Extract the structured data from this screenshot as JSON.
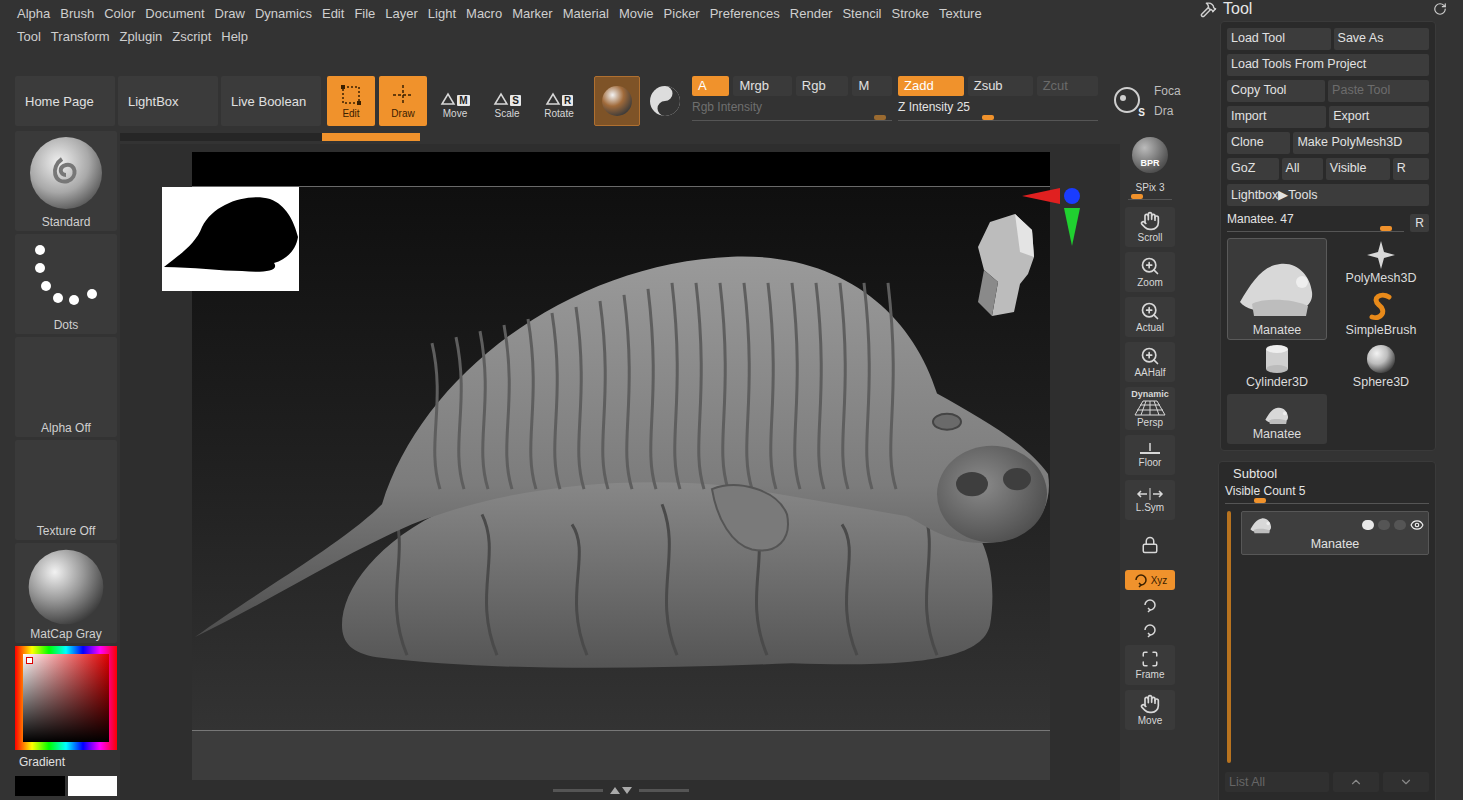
{
  "menu_bar": {
    "rows": [
      [
        "Alpha",
        "Brush",
        "Color",
        "Document",
        "Draw",
        "Dynamics",
        "Edit",
        "File",
        "Layer",
        "Light",
        "Macro",
        "Marker",
        "Material",
        "Movie",
        "Picker",
        "Preferences",
        "Render",
        "Stencil",
        "Stroke",
        "Texture"
      ],
      [
        "Tool",
        "Transform",
        "Zplugin",
        "Zscript",
        "Help"
      ]
    ]
  },
  "top_shelf": {
    "nav_buttons": [
      {
        "label": "Home Page"
      },
      {
        "label": "LightBox"
      },
      {
        "label": "Live Boolean"
      }
    ],
    "modes": [
      {
        "label": "Edit",
        "key": "",
        "kind": "edit",
        "selected": true
      },
      {
        "label": "Draw",
        "key": "",
        "kind": "draw",
        "selected": true
      },
      {
        "label": "Move",
        "key": "M",
        "kind": "key",
        "selected": false
      },
      {
        "label": "Scale",
        "key": "S",
        "kind": "key",
        "selected": false
      },
      {
        "label": "Rotate",
        "key": "R",
        "kind": "key",
        "selected": false
      }
    ],
    "color_modes": [
      {
        "label": "A",
        "selected": true,
        "disabled": false
      },
      {
        "label": "Mrgb",
        "selected": false,
        "disabled": false
      },
      {
        "label": "Rgb",
        "selected": false,
        "disabled": false
      },
      {
        "label": "M",
        "selected": false,
        "disabled": false
      }
    ],
    "z_modes": [
      {
        "label": "Zadd",
        "selected": true,
        "disabled": false
      },
      {
        "label": "Zsub",
        "selected": false,
        "disabled": false
      },
      {
        "label": "Zcut",
        "selected": false,
        "disabled": true
      }
    ],
    "sliders": [
      {
        "label": "Rgb Intensity",
        "level": 0.97,
        "disabled": true
      },
      {
        "label": "Z Intensity 25",
        "level": 0.48,
        "disabled": false
      }
    ],
    "stroke_key": "S",
    "cut_labels": [
      "Foca",
      "Dra"
    ]
  },
  "left_shelf": {
    "tiles": [
      {
        "label": "Standard",
        "kind": "brush"
      },
      {
        "label": "Dots",
        "kind": "stroke"
      },
      {
        "label": "Alpha Off",
        "kind": "empty"
      },
      {
        "label": "Texture Off",
        "kind": "empty"
      },
      {
        "label": "MatCap Gray",
        "kind": "material"
      }
    ],
    "gradient": {
      "label": "Gradient",
      "swatches": [
        {
          "color": "#000000"
        },
        {
          "color": "#ffffff"
        }
      ]
    }
  },
  "right_shelf": {
    "items": [
      {
        "label": "BPR",
        "kind": "render",
        "selected": false
      },
      {
        "label": "SPix 3",
        "kind": "slider",
        "level": 0.35,
        "selected": false
      },
      {
        "label": "Scroll",
        "kind": "scroll",
        "selected": false
      },
      {
        "label": "Zoom",
        "kind": "zoom",
        "selected": false
      },
      {
        "label": "Actual",
        "kind": "actual",
        "selected": false
      },
      {
        "label": "AAHalf",
        "kind": "aahalf",
        "selected": false
      },
      {
        "label": "Persp",
        "top": "Dynamic",
        "kind": "persp",
        "selected": false
      },
      {
        "label": "Floor",
        "kind": "floor",
        "selected": false
      },
      {
        "label": "L.Sym",
        "kind": "lsym",
        "selected": false
      },
      {
        "kind": "lock",
        "selected": false
      },
      {
        "label": "Xyz",
        "kind": "xyz",
        "selected": true
      },
      {
        "kind": "rotate-y",
        "selected": false
      },
      {
        "kind": "rotate-z",
        "selected": false
      },
      {
        "label": "Frame",
        "kind": "frame",
        "selected": false
      },
      {
        "label": "Move",
        "kind": "move",
        "selected": false
      }
    ]
  },
  "tool_panel": {
    "title": "Tool",
    "buttons": [
      [
        {
          "label": "Load Tool",
          "disabled": false
        },
        {
          "label": "Save As",
          "disabled": false
        }
      ],
      [
        {
          "label": "Load Tools From Project",
          "disabled": false
        }
      ],
      [
        {
          "label": "Copy Tool",
          "disabled": false
        },
        {
          "label": "Paste Tool",
          "disabled": true
        }
      ],
      [
        {
          "label": "Import",
          "disabled": false
        },
        {
          "label": "Export",
          "disabled": false
        }
      ],
      [
        {
          "label": "Clone",
          "disabled": false
        },
        {
          "label": "Make PolyMesh3D",
          "disabled": false
        }
      ],
      [
        {
          "label": "GoZ",
          "disabled": false
        },
        {
          "label": "All",
          "disabled": false
        },
        {
          "label": "Visible",
          "disabled": false
        },
        {
          "label": "R",
          "disabled": false
        }
      ],
      [
        {
          "label": "Lightbox▶Tools",
          "disabled": false
        }
      ]
    ],
    "tool_slider": {
      "label": "Manatee. 47",
      "level": 0.93,
      "reset": "R"
    },
    "current_tool": {
      "label": "Manatee",
      "selected": true
    },
    "tools": [
      {
        "label": "PolyMesh3D",
        "kind": "polymesh"
      },
      {
        "label": "SimpleBrush",
        "kind": "simplebrush"
      },
      {
        "label": "Cylinder3D",
        "kind": "cylinder"
      },
      {
        "label": "Sphere3D",
        "kind": "sphere"
      },
      {
        "label": "Manatee",
        "kind": "manatee"
      }
    ]
  },
  "subtool": {
    "title": "Subtool",
    "slider": {
      "label": "Visible Count 5",
      "level": 0.2
    },
    "items": [
      {
        "label": "Manatee",
        "selected": true,
        "visible": true
      }
    ],
    "footer": {
      "label": "List All",
      "disabled": true
    }
  }
}
